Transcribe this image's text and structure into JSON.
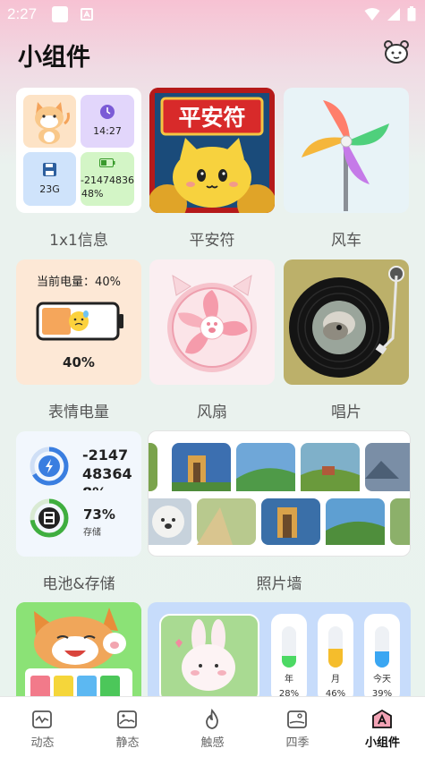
{
  "status": {
    "time": "2:27"
  },
  "header": {
    "title": "小组件"
  },
  "widgets": {
    "info": {
      "label": "1x1信息",
      "clock_time": "14:27",
      "storage": "23G",
      "battery_line1": "-21474836",
      "battery_line2": "48%"
    },
    "pinganfu": {
      "label": "平安符",
      "banner": "平安符"
    },
    "windmill": {
      "label": "风车"
    },
    "emoji_battery": {
      "label": "表情电量",
      "header": "当前电量：40%",
      "percent_text": "40%",
      "level": 0.4
    },
    "fan": {
      "label": "风扇"
    },
    "record": {
      "label": "唱片"
    },
    "battery_storage": {
      "label": "电池&存储",
      "battery_lines": [
        "-2147",
        "48364",
        "8%"
      ],
      "storage_percent": "73%",
      "storage_label": "存储",
      "storage_level": 0.73
    },
    "photo_wall": {
      "label": "照片墙"
    },
    "meters": [
      {
        "name": "年",
        "percent": "28%",
        "level": 0.28,
        "color": "#4cd964"
      },
      {
        "name": "月",
        "percent": "46%",
        "level": 0.46,
        "color": "#f5bd2c"
      },
      {
        "name": "今天",
        "percent": "39%",
        "level": 0.39,
        "color": "#3aa6f2"
      }
    ]
  },
  "nav": [
    {
      "label": "动态",
      "icon": "wave-picture-icon"
    },
    {
      "label": "静态",
      "icon": "landscape-picture-icon"
    },
    {
      "label": "触感",
      "icon": "flame-icon"
    },
    {
      "label": "四季",
      "icon": "season-picture-icon"
    },
    {
      "label": "小组件",
      "icon": "widget-a-icon"
    }
  ],
  "colors": {
    "accent": "#e8325b"
  }
}
